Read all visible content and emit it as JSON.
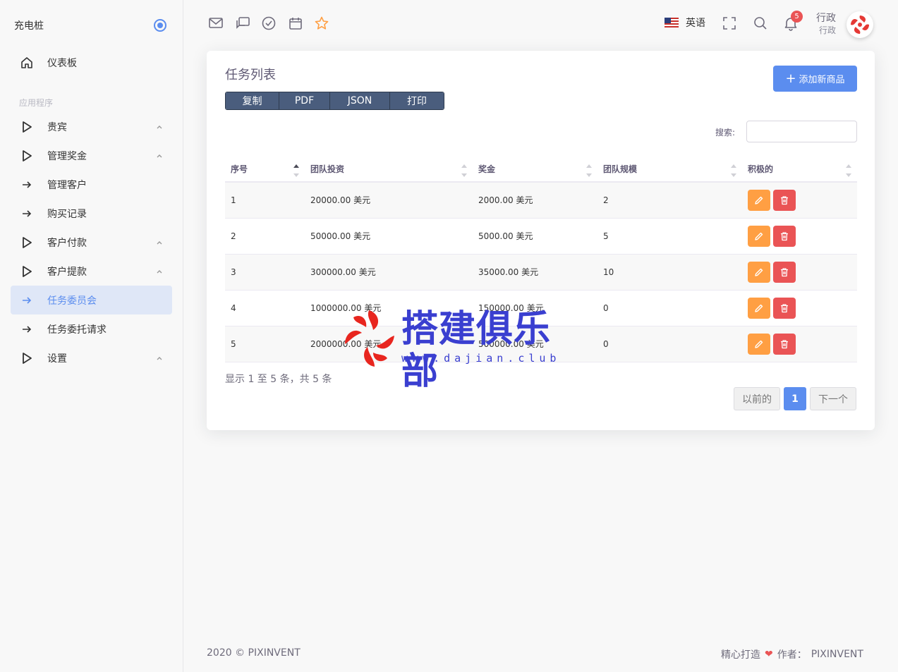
{
  "sidebar": {
    "brand": "充电桩",
    "dashboard": "仪表板",
    "section": "应用程序",
    "items": [
      {
        "label": "贵宾"
      },
      {
        "label": "管理奖金"
      },
      {
        "label": "管理客户"
      },
      {
        "label": "购买记录"
      },
      {
        "label": "客户付款"
      },
      {
        "label": "客户提款"
      },
      {
        "label": "任务委员会"
      },
      {
        "label": "任务委托请求"
      },
      {
        "label": "设置"
      }
    ]
  },
  "header": {
    "language": "英语",
    "notification_count": "5",
    "user_name": "行政",
    "user_role": "行政"
  },
  "card": {
    "title": "任务列表",
    "add_button": "添加新商品",
    "export_buttons": [
      "复制",
      "PDF",
      "JSON",
      "打印"
    ],
    "search_label": "搜索:",
    "search_value": "",
    "columns": [
      "序号",
      "团队投资",
      "奖金",
      "团队规模",
      "积极的"
    ],
    "rows": [
      {
        "no": "1",
        "investment": "20000.00 美元",
        "bonus": "2000.00 美元",
        "size": "2"
      },
      {
        "no": "2",
        "investment": "50000.00 美元",
        "bonus": "5000.00 美元",
        "size": "5"
      },
      {
        "no": "3",
        "investment": "300000.00 美元",
        "bonus": "35000.00 美元",
        "size": "10"
      },
      {
        "no": "4",
        "investment": "1000000.00 美元",
        "bonus": "150000.00 美元",
        "size": "0"
      },
      {
        "no": "5",
        "investment": "2000000.00 美元",
        "bonus": "500000.00 美元",
        "size": "0"
      }
    ],
    "info": "显示 1 至 5 条，共 5 条",
    "pager": {
      "prev": "以前的",
      "current": "1",
      "next": "下一个"
    }
  },
  "watermark": {
    "title": "搭建俱乐部",
    "url": "www.dajian.club"
  },
  "footer": {
    "copyright": "2020 © PIXINVENT",
    "crafted": "精心打造",
    "by": "作者：",
    "author": "PIXINVENT"
  },
  "colors": {
    "primary": "#5b8def",
    "warning": "#ff9f43",
    "danger": "#ea5455",
    "export_btn": "#4a5d7d"
  }
}
